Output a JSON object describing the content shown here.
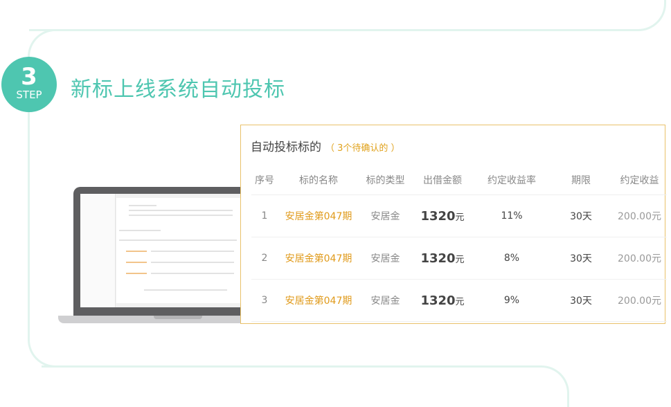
{
  "step": {
    "number": "3",
    "label": "STEP"
  },
  "section_title": "新标上线系统自动投标",
  "panel": {
    "title": "自动投标标的",
    "subtitle": "（ 3个待确认的 ）",
    "columns": [
      "序号",
      "标的名称",
      "标的类型",
      "出借金额",
      "约定收益率",
      "期限",
      "约定收益"
    ],
    "rows": [
      {
        "index": "1",
        "name": "安居金第047期",
        "type": "安居金",
        "amount": "1320",
        "unit": "元",
        "rate": "11%",
        "term": "30天",
        "income": "200.00元"
      },
      {
        "index": "2",
        "name": "安居金第047期",
        "type": "安居金",
        "amount": "1320",
        "unit": "元",
        "rate": "8%",
        "term": "30天",
        "income": "200.00元"
      },
      {
        "index": "3",
        "name": "安居金第047期",
        "type": "安居金",
        "amount": "1320",
        "unit": "元",
        "rate": "9%",
        "term": "30天",
        "income": "200.00元"
      }
    ]
  },
  "colors": {
    "teal": "#4ec6b0",
    "orange": "#e09a1a",
    "panel_border": "#e9c169",
    "deco": "#e1f4ee"
  }
}
